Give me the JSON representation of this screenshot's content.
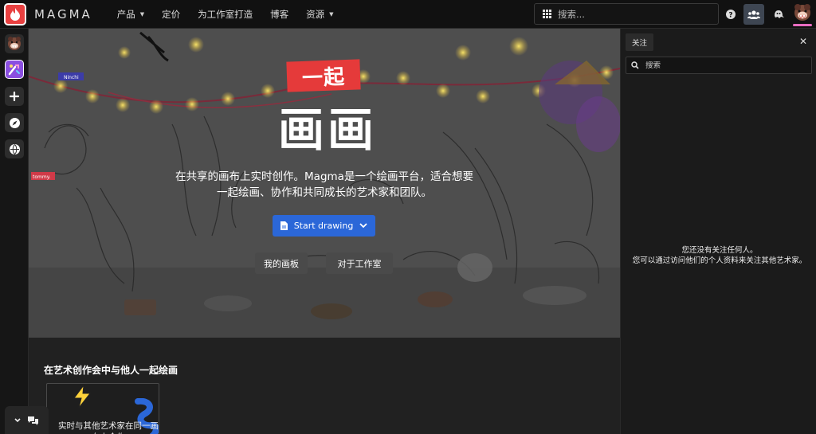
{
  "header": {
    "logo_text": "MAGMA",
    "nav": [
      {
        "label": "产品",
        "has_dropdown": true
      },
      {
        "label": "定价",
        "has_dropdown": false
      },
      {
        "label": "为工作室打造",
        "has_dropdown": false
      },
      {
        "label": "博客",
        "has_dropdown": false
      },
      {
        "label": "资源",
        "has_dropdown": true
      }
    ],
    "search_placeholder": "搜索...",
    "icons": [
      "grid-icon",
      "help-icon",
      "people-icon",
      "ghost-icon",
      "avatar"
    ]
  },
  "sidebar": {
    "items": [
      "avatar",
      "community-icon",
      "plus-icon",
      "compass-icon",
      "globe-icon"
    ]
  },
  "hero": {
    "title_line1": "一起",
    "title_line2": "画画",
    "description_line1": "在共享的画布上实时创作。Magma是一个绘画平台，适合想要",
    "description_line2": "一起绘画、协作和共同成长的艺术家和团队。",
    "start_button": "Start drawing",
    "my_boards_button": "我的画板",
    "studio_button": "对于工作室",
    "canvas_tags": [
      "Ninchi",
      "tommy."
    ]
  },
  "lower": {
    "section_title": "在艺术创作会中与他人一起绘画",
    "card_text": "实时与其他艺术家在同一画布上合作"
  },
  "right_panel": {
    "tab_label": "关注",
    "search_placeholder": "搜索",
    "empty_line1": "您还没有关注任何人。",
    "empty_line2": "您可以通过访问他们的个人资料来关注其他艺术家。"
  },
  "colors": {
    "brand_red": "#e94040",
    "primary_blue": "#2b67d8",
    "accent_purple": "#8a4fe0"
  }
}
